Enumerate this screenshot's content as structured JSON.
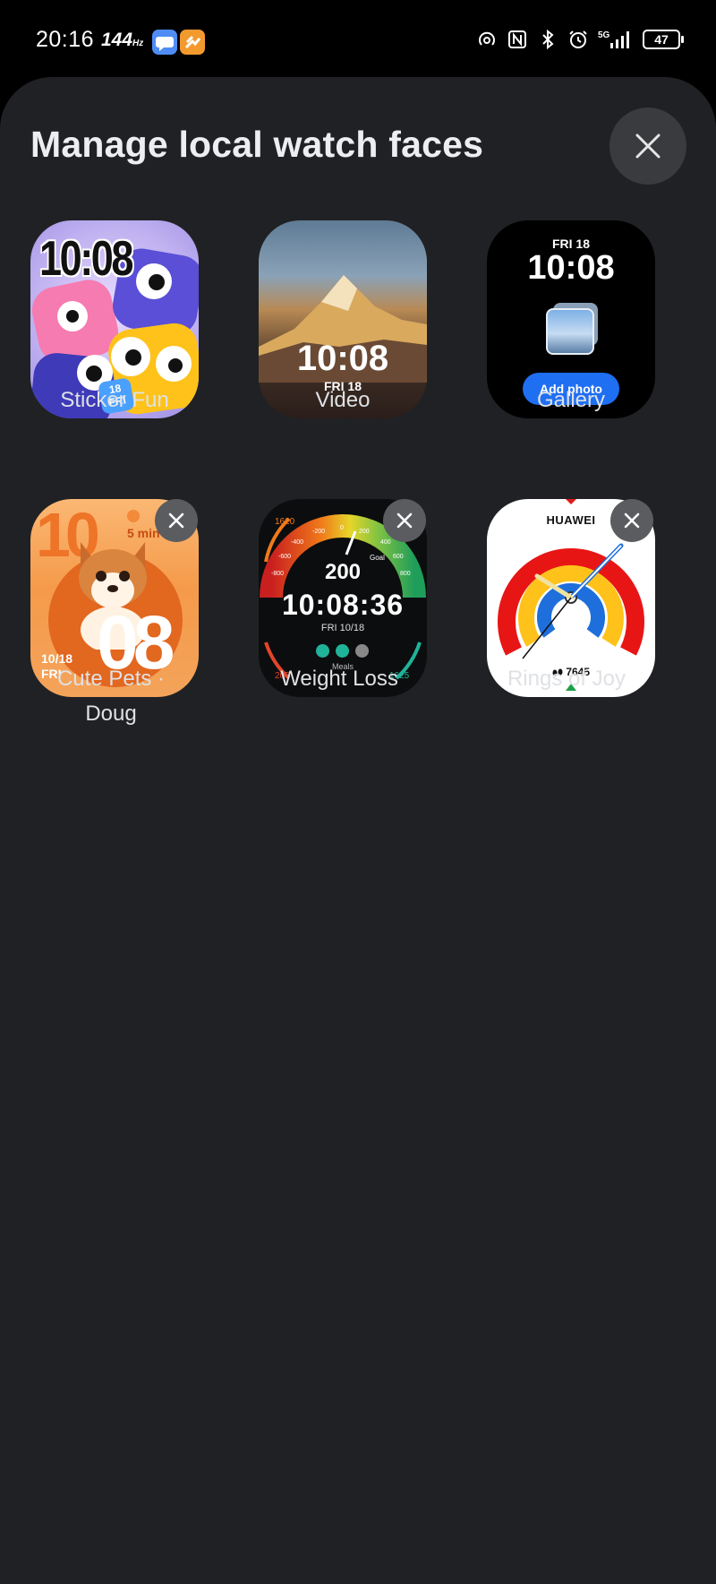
{
  "status_bar": {
    "time": "20:16",
    "refresh_rate": "144",
    "refresh_unit": "Hz",
    "battery": "47",
    "network": "5G"
  },
  "sheet": {
    "title": "Manage local watch faces",
    "close_icon": "close-icon"
  },
  "faces": [
    {
      "label": "Sticker Fun",
      "time": "10:08",
      "day_num": "18",
      "day": "FRI",
      "deletable": false
    },
    {
      "label": "Video",
      "time": "10:08",
      "date": "FRI 18",
      "deletable": false
    },
    {
      "label": "Gallery",
      "time": "10:08",
      "date": "FRI 18",
      "button": "Add photo",
      "deletable": false
    },
    {
      "label_line1": "Cute Pets ·",
      "label_line2": "Doug",
      "time_left": "10",
      "time_right": "08",
      "badge": "5 min",
      "date_line1": "10/18",
      "date_line2": "FRI",
      "deletable": true
    },
    {
      "label": "Weight Loss",
      "value": "200",
      "time": "10:08:36",
      "date": "FRI 10/18",
      "meals": "Meals",
      "left_top": "1620",
      "left_bottom": "205",
      "right_bottom": "1625",
      "goal": "Goal",
      "scale": [
        "-800",
        "-600",
        "-400",
        "-200",
        "0",
        "200",
        "400",
        "600",
        "800"
      ],
      "deletable": true
    },
    {
      "label": "Rings of Joy",
      "brand": "HUAWEI",
      "steps": "7645",
      "deletable": true
    }
  ],
  "colors": {
    "sheet_bg": "#202124",
    "accent_blue": "#1f6ff2"
  }
}
